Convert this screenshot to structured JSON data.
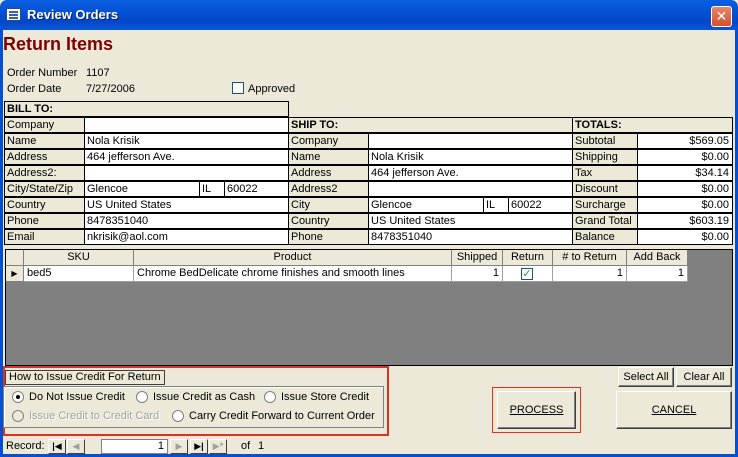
{
  "window": {
    "title": "Review Orders",
    "close_glyph": "✕"
  },
  "heading": "Return Items",
  "order": {
    "number_label": "Order Number",
    "number": "1107",
    "date_label": "Order Date",
    "date": "7/27/2006",
    "approved_label": "Approved"
  },
  "bill_to": {
    "header": "BILL TO:",
    "rows": [
      {
        "label": "Company",
        "value": ""
      },
      {
        "label": "Name",
        "value": "Nola Krisik"
      },
      {
        "label": "Address",
        "value": "464 jefferson Ave."
      },
      {
        "label": "Address2:",
        "value": ""
      },
      {
        "label": "City/State/Zip",
        "city": "Glencoe",
        "state": "IL",
        "zip": "60022"
      },
      {
        "label": "Country",
        "value": "US United States"
      },
      {
        "label": "Phone",
        "value": "8478351040"
      },
      {
        "label": "Email",
        "value": "nkrisik@aol.com"
      }
    ]
  },
  "ship_to": {
    "header": "SHIP TO:",
    "rows": [
      {
        "label": "Company",
        "value": ""
      },
      {
        "label": "Name",
        "value": "Nola Krisik"
      },
      {
        "label": "Address",
        "value": "464 jefferson Ave."
      },
      {
        "label": "Address2",
        "value": ""
      },
      {
        "label": "City",
        "city": "Glencoe",
        "state": "IL",
        "zip": "60022"
      },
      {
        "label": "Country",
        "value": "US United States"
      },
      {
        "label": "Phone",
        "value": "8478351040"
      }
    ]
  },
  "totals": {
    "header": "TOTALS:",
    "rows": [
      {
        "label": "Subtotal",
        "value": "$569.05"
      },
      {
        "label": "Shipping",
        "value": "$0.00"
      },
      {
        "label": "Tax",
        "value": "$34.14"
      },
      {
        "label": "Discount",
        "value": "$0.00"
      },
      {
        "label": "Surcharge",
        "value": "$0.00"
      },
      {
        "label": "Grand Total",
        "value": "$603.19"
      },
      {
        "label": "Balance",
        "value": "$0.00"
      }
    ]
  },
  "items": {
    "columns": [
      "SKU",
      "Product",
      "Shipped",
      "Return",
      "# to Return",
      "Add Back"
    ],
    "rows": [
      {
        "sku": "bed5",
        "product": "Chrome BedDelicate chrome finishes and smooth lines",
        "shipped": "1",
        "return": true,
        "to_return": "1",
        "add_back": "1"
      }
    ],
    "row_selector_glyph": "▶",
    "check_glyph": "✓"
  },
  "buttons": {
    "select_all": "Select All",
    "clear_all": "Clear All",
    "process": "PROCESS",
    "cancel": "CANCEL"
  },
  "credit": {
    "legend": "How to Issue Credit For Return",
    "options": [
      {
        "label": "Do Not Issue Credit",
        "selected": true,
        "enabled": true
      },
      {
        "label": "Issue Credit as Cash",
        "selected": false,
        "enabled": true
      },
      {
        "label": "Issue Store Credit",
        "selected": false,
        "enabled": true
      },
      {
        "label": "Issue Credit to Credit Card",
        "selected": false,
        "enabled": false
      },
      {
        "label": "Carry Credit Forward to Current Order",
        "selected": false,
        "enabled": true
      }
    ]
  },
  "record_nav": {
    "label": "Record:",
    "current": "1",
    "of_label": "of",
    "total": "1",
    "first_glyph": "|◀",
    "prev_glyph": "◀",
    "next_glyph": "▶",
    "last_glyph": "▶|",
    "new_glyph": "▶*"
  },
  "colors": {
    "heading": "#800000",
    "titlebar": "#0451d6",
    "highlight_border": "#e03020"
  }
}
